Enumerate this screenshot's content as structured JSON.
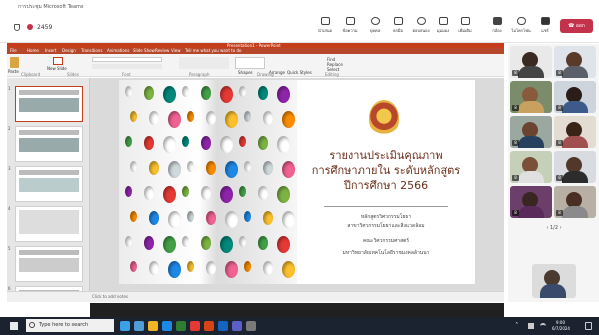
{
  "window": {
    "title": "การประชุม Microsoft Teams",
    "timer": "2459",
    "leave_label": "ออก"
  },
  "teams_toolbar": [
    {
      "icon": "share-tray-icon",
      "label": "นำเสนอ"
    },
    {
      "icon": "chat-icon",
      "label": "ข้อความ"
    },
    {
      "icon": "people-icon",
      "label": "บุคคล"
    },
    {
      "icon": "raise-hand-icon",
      "label": "ยกมือ"
    },
    {
      "icon": "react-icon",
      "label": "ตอบสนอง"
    },
    {
      "icon": "view-icon",
      "label": "มุมมอง"
    },
    {
      "icon": "more-icon",
      "label": "เพิ่มเติม"
    },
    {
      "icon": "camera-icon",
      "label": "กล้อง"
    },
    {
      "icon": "mic-icon",
      "label": "ไมโครโฟน"
    },
    {
      "icon": "share-icon",
      "label": "แชร์"
    }
  ],
  "ppt": {
    "titlebar": "Presentation1 - PowerPoint",
    "tabs": [
      "File",
      "Home",
      "Insert",
      "Design",
      "Transitions",
      "Animations",
      "Slide Show",
      "Review",
      "View",
      "Tell me what you want to do"
    ],
    "ribbon_groups": [
      "Clipboard",
      "Slides",
      "Font",
      "Paragraph",
      "Drawing",
      "Editing"
    ],
    "ribbon_buttons": [
      "Paste",
      "New Slide",
      "Shapes",
      "Arrange",
      "Quick Styles",
      "Find",
      "Replace",
      "Select"
    ],
    "status": "Click to add notes"
  },
  "slide": {
    "title_lines": [
      "รายงานประเมินคุณภาพ",
      "การศึกษาภายใน ระดับหลักสูตร",
      "ปีการศึกษา 2566"
    ],
    "sub_lines": [
      "หลักสูตรวิศวกรรมโยธา",
      "สาขาวิศวกรรมโยธาและสิ่งแวดล้อม",
      "คณะวิศวกรรมศาสตร์",
      "มหาวิทยาลัยเทคโนโลยีราชมงคลล้านนา"
    ]
  },
  "gallery": {
    "pager": "1/2",
    "tiles": [
      "8",
      "8",
      "8",
      "8",
      "8",
      "8",
      "8",
      "8",
      "8",
      "8"
    ]
  },
  "windows_taskbar": {
    "search_placeholder": "Type here to search",
    "tray_time": "9:00",
    "tray_date": "6/7/2024"
  },
  "colors": {
    "ppt_accent": "#c43e1c",
    "teams_leave": "#c4314b",
    "slide_title": "#6b2e1a"
  }
}
